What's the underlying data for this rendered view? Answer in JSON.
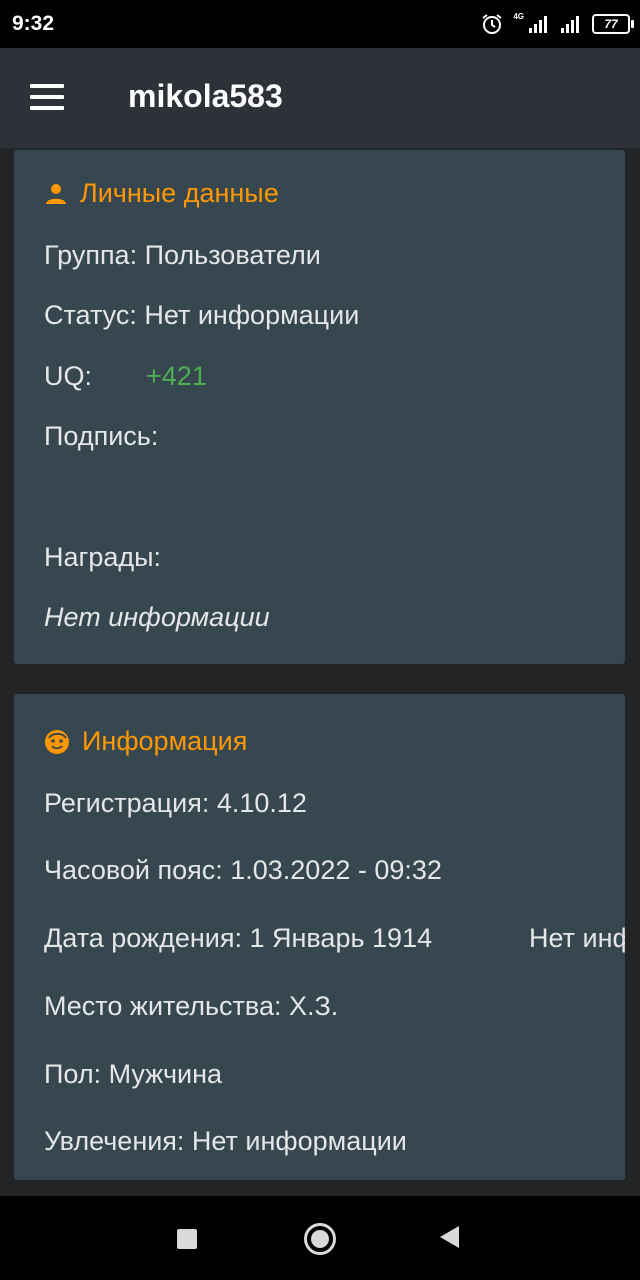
{
  "status_bar": {
    "time": "9:32",
    "network_label": "4G",
    "battery": "77"
  },
  "app_bar": {
    "title": "mikola583",
    "menu_icon": "hamburger-menu-icon"
  },
  "personal_card": {
    "title": "Личные данные",
    "title_icon": "person-icon",
    "group": "Группа: Пользователи",
    "status": "Статус: Нет информации",
    "uq_label": "UQ:",
    "uq_value": "+421",
    "signature_label": "Подпись:",
    "awards_label": "Награды:",
    "awards_value": "Нет информации"
  },
  "info_card": {
    "title": "Информация",
    "title_icon": "smiley-face-icon",
    "registration": "Регистрация: 4.10.12",
    "timezone": "Часовой пояс: 1.03.2022 - 09:32",
    "birthday": "Дата рождения: 1 Январь 1914",
    "birthday_overflow": "Нет инф",
    "residence": "Место жительства: Х.З.",
    "gender": "Пол: Мужчина",
    "hobbies": "Увлечения: Нет информации"
  },
  "colors": {
    "accent": "#ff9800",
    "positive": "#4caf50",
    "card_bg": "#37474f",
    "app_bar_bg": "#2c3238"
  },
  "nav_bar": {
    "recents_icon": "square-recents-icon",
    "home_icon": "circle-home-icon",
    "back_icon": "triangle-back-icon"
  }
}
